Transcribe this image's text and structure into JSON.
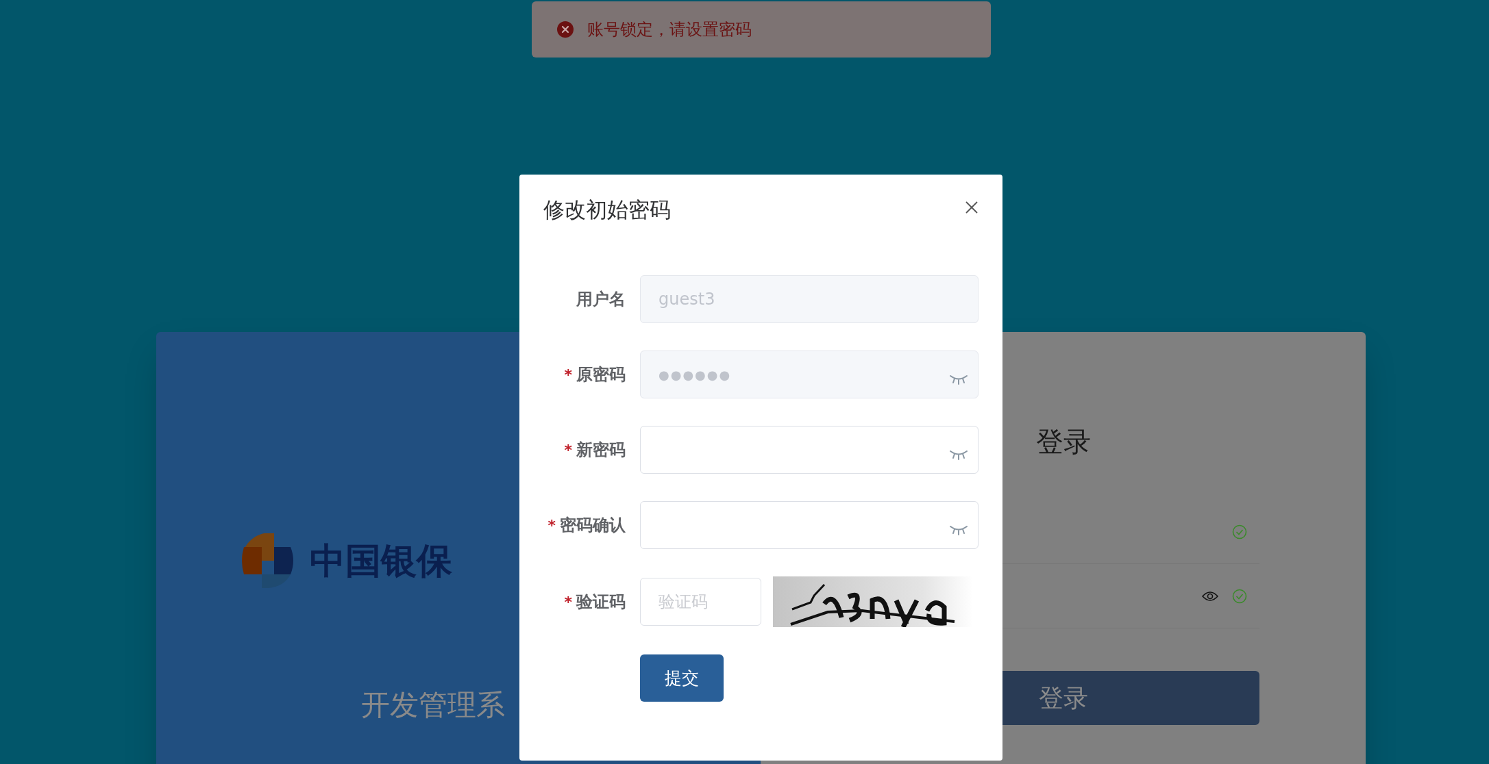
{
  "toast": {
    "kind": "error",
    "message": "账号锁定，请设置密码"
  },
  "login_card": {
    "logo_text": "中国银保",
    "subtitle": "开发管理系",
    "title": "登录",
    "fields": [
      {
        "kind": "text",
        "valid": true
      },
      {
        "kind": "password",
        "valid": true
      }
    ],
    "button": "登录"
  },
  "dialog": {
    "title": "修改初始密码",
    "required_mark": "*",
    "fields": [
      {
        "label": "用户名",
        "required": false,
        "kind": "text",
        "value": "guest3",
        "disabled": true
      },
      {
        "label": "原密码",
        "required": true,
        "kind": "password",
        "value": "●●●●●●",
        "disabled": true
      },
      {
        "label": "新密码",
        "required": true,
        "kind": "password"
      },
      {
        "label": "密码确认",
        "required": true,
        "kind": "password"
      },
      {
        "label": "验证码",
        "required": true,
        "kind": "captcha",
        "placeholder": "验证码"
      }
    ],
    "submit": "提交"
  }
}
